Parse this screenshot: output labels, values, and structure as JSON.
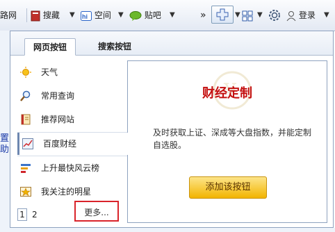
{
  "toolbar": {
    "site_label": "路网",
    "souzang_label": "搜藏",
    "kongjian_label": "空间",
    "tieba_label": "贴吧",
    "overflow_glyph": "»",
    "login_label": "登录"
  },
  "background": {
    "left_link_text": "置\n助"
  },
  "panel": {
    "tabs": [
      {
        "label": "网页按钮",
        "active": true
      },
      {
        "label": "搜索按钮",
        "active": false
      }
    ],
    "items": [
      {
        "label": "天气",
        "icon": "sun-icon",
        "selected": false
      },
      {
        "label": "常用查询",
        "icon": "magnifier-icon",
        "selected": false
      },
      {
        "label": "推荐网站",
        "icon": "book-icon",
        "selected": false
      },
      {
        "label": "百度财经",
        "icon": "stock-chart-icon",
        "selected": true
      },
      {
        "label": "上升最快风云榜",
        "icon": "ranking-icon",
        "selected": false
      },
      {
        "label": "我关注的明星",
        "icon": "star-photo-icon",
        "selected": false
      }
    ],
    "pager": {
      "pages": [
        "1",
        "2"
      ],
      "current": "1",
      "more_label": "更多..."
    },
    "detail": {
      "title": "财经定制",
      "description": "及时获取上证、深成等大盘指数，并能定制自选股。",
      "add_button_label": "添加该按钮"
    }
  },
  "colors": {
    "title_red": "#c41010",
    "highlight_border": "#d9232a",
    "button_gold": "#f2b400"
  }
}
